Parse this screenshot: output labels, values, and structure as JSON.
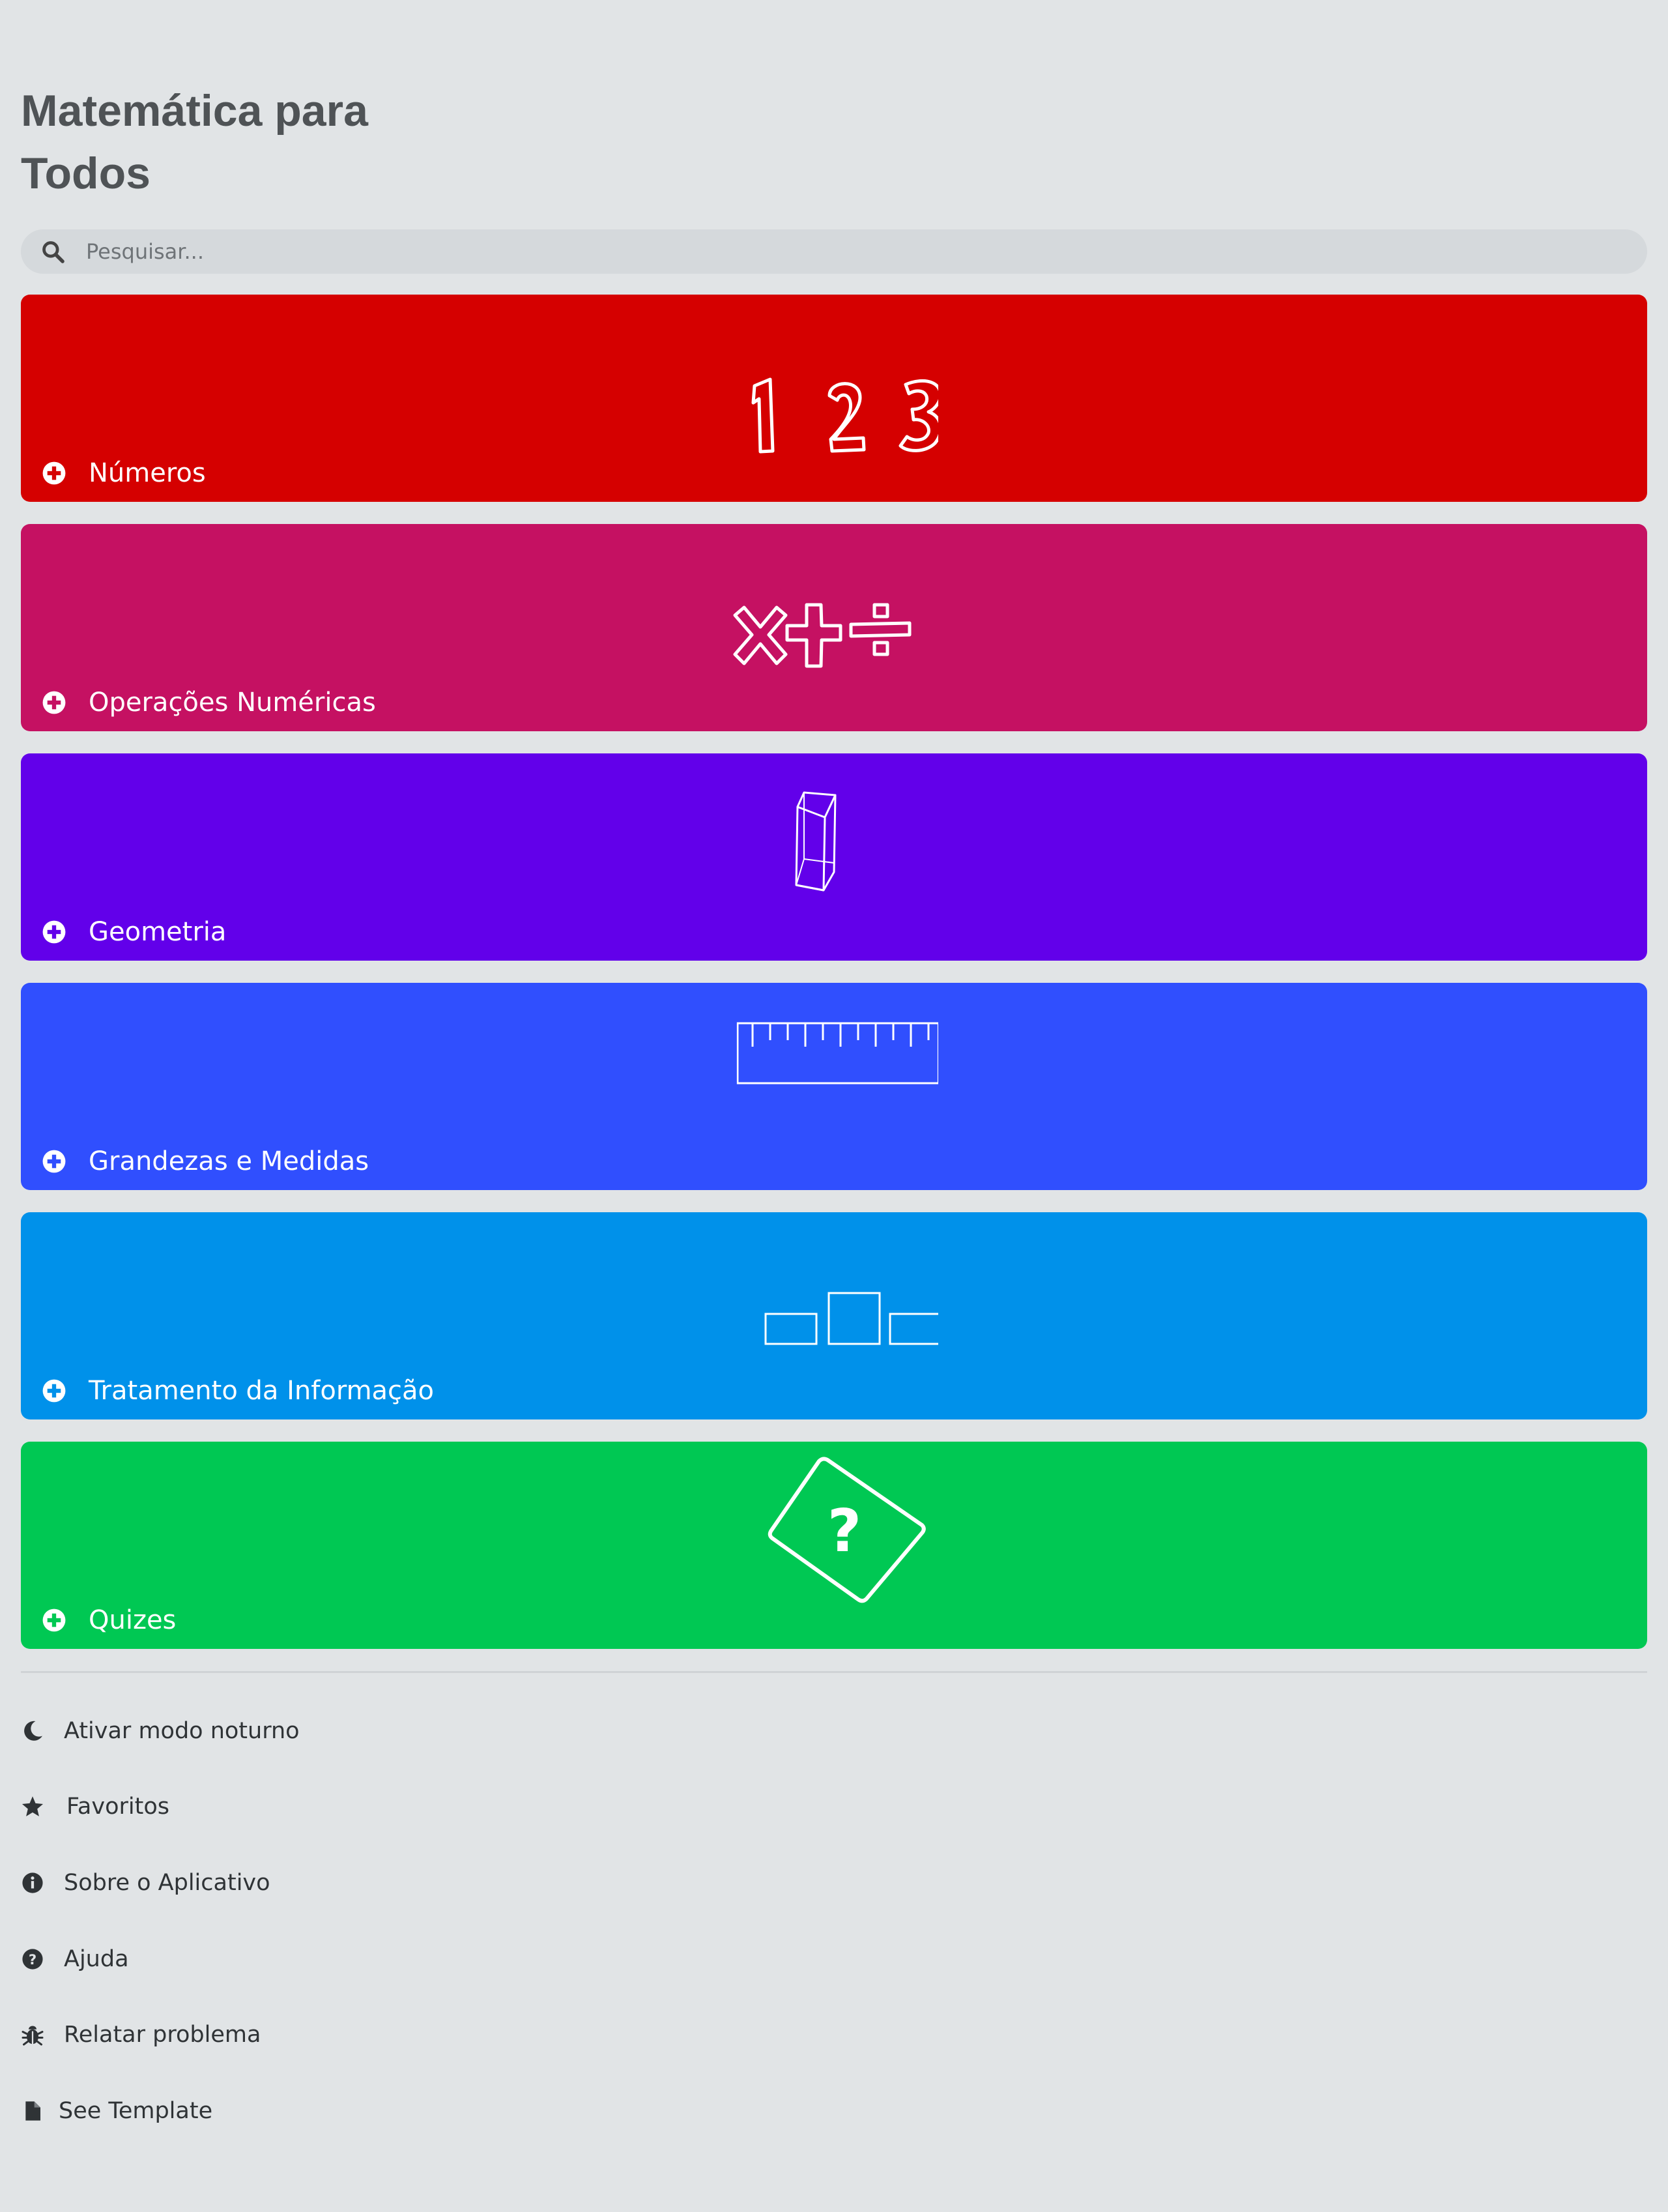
{
  "app": {
    "title": "Matemática para Todos"
  },
  "search": {
    "placeholder": "Pesquisar..."
  },
  "categories": [
    {
      "label": "Números",
      "color": "#d50000",
      "icon": "numbers-123-icon"
    },
    {
      "label": "Operações Numéricas",
      "color": "#c51162",
      "icon": "operations-icon"
    },
    {
      "label": "Geometria",
      "color": "#6200ea",
      "icon": "cube-icon"
    },
    {
      "label": "Grandezas e Medidas",
      "color": "#304ffe",
      "icon": "ruler-icon"
    },
    {
      "label": "Tratamento da Informação",
      "color": "#0091ea",
      "icon": "bar-chart-icon"
    },
    {
      "label": "Quizes",
      "color": "#00c853",
      "icon": "question-card-icon"
    }
  ],
  "menu": [
    {
      "label": "Ativar modo noturno",
      "icon": "moon-icon"
    },
    {
      "label": "Favoritos",
      "icon": "star-icon"
    },
    {
      "label": "Sobre o Aplicativo",
      "icon": "info-icon"
    },
    {
      "label": "Ajuda",
      "icon": "help-icon"
    },
    {
      "label": "Relatar problema",
      "icon": "bug-icon"
    },
    {
      "label": "See Template",
      "icon": "file-icon"
    }
  ]
}
